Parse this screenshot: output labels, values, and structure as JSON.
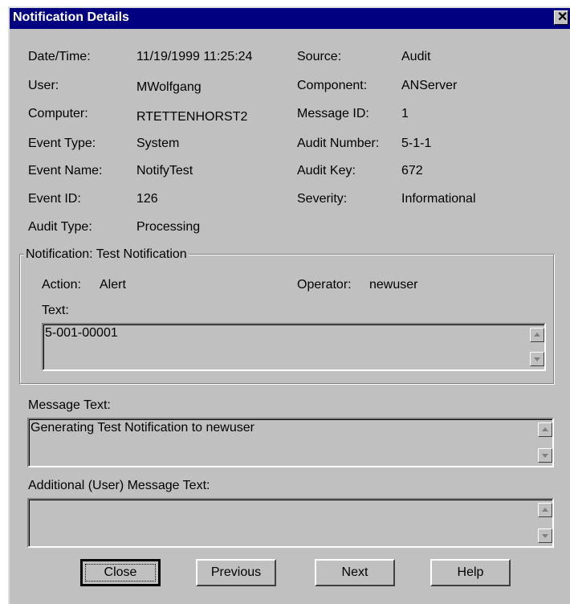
{
  "window": {
    "title": "Notification Details"
  },
  "details": {
    "left": [
      {
        "label": "Date/Time:",
        "value": "11/19/1999 11:25:24"
      },
      {
        "label": "User:",
        "value": "MWolfgang"
      },
      {
        "label": "Computer:",
        "value": "RTETTENHORST2"
      },
      {
        "label": "Event Type:",
        "value": "System"
      },
      {
        "label": "Event Name:",
        "value": "NotifyTest"
      },
      {
        "label": "Event ID:",
        "value": "126"
      },
      {
        "label": "Audit Type:",
        "value": "Processing"
      }
    ],
    "right": [
      {
        "label": "Source:",
        "value": "Audit"
      },
      {
        "label": "Component:",
        "value": "ANServer"
      },
      {
        "label": "Message ID:",
        "value": "1"
      },
      {
        "label": "Audit Number:",
        "value": "5-1-1"
      },
      {
        "label": "Audit Key:",
        "value": "672"
      },
      {
        "label": "Severity:",
        "value": "Informational"
      }
    ]
  },
  "notification": {
    "group_title": "Notification: Test Notification",
    "action_label": "Action:",
    "action_value": "Alert",
    "operator_label": "Operator:",
    "operator_value": "newuser",
    "text_label": "Text:",
    "text_value": "5-001-00001"
  },
  "message": {
    "label": "Message Text:",
    "value": "Generating Test Notification to newuser"
  },
  "additional": {
    "label": "Additional (User) Message Text:",
    "value": ""
  },
  "buttons": {
    "close": "Close",
    "previous": "Previous",
    "next": "Next",
    "help": "Help"
  }
}
